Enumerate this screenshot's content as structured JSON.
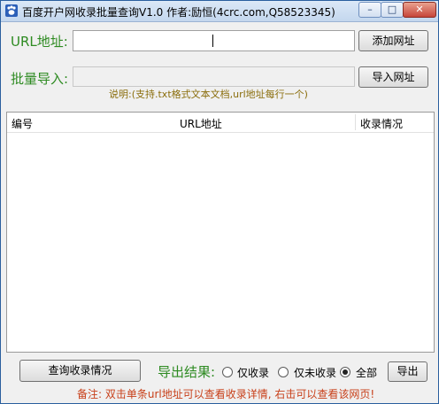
{
  "window": {
    "title": "百度开户网收录批量查询V1.0  作者:励恒(4crc.com,Q58523345)",
    "minimize_glyph": "–",
    "maximize_glyph": "□",
    "close_glyph": "✕"
  },
  "url_row": {
    "label": "URL地址:",
    "value": "",
    "add_button": "添加网址"
  },
  "import_row": {
    "label": "批量导入:",
    "value": "",
    "import_button": "导入网址",
    "hint": "说明:(支持.txt格式文本文档,url地址每行一个)"
  },
  "table": {
    "columns": [
      "编号",
      "URL地址",
      "收录情况"
    ],
    "rows": []
  },
  "bottom": {
    "query_button": "查询收录情况",
    "export_label": "导出结果:",
    "options": [
      {
        "label": "仅收录",
        "checked": false
      },
      {
        "label": "仅未收录",
        "checked": false
      },
      {
        "label": "全部",
        "checked": true
      }
    ],
    "export_button": "导出"
  },
  "note": "备注: 双击单条url地址可以查看收录详情, 右击可以查看该网页!",
  "colors": {
    "label_green": "#2e8b22",
    "hint_text": "#8a6d0b",
    "note_text": "#c8401a"
  }
}
